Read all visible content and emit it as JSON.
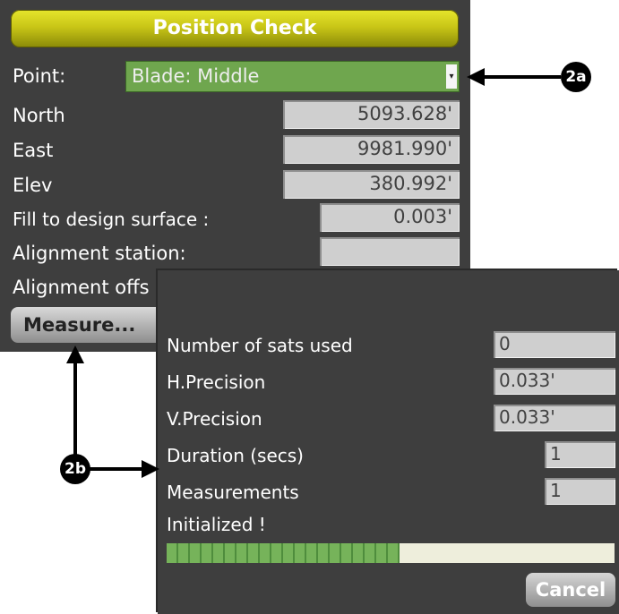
{
  "position_check": {
    "title": "Position Check",
    "point_label": "Point:",
    "point_value": "Blade: Middle",
    "fields": [
      {
        "label": "North",
        "value": "5093.628'"
      },
      {
        "label": "East",
        "value": "9981.990'"
      },
      {
        "label": "Elev",
        "value": "380.992'"
      },
      {
        "label": "Fill to design surface :",
        "value": "0.003'"
      },
      {
        "label": "Alignment station:",
        "value": ""
      },
      {
        "label": "Alignment offs",
        "value": ""
      }
    ],
    "measure_button": "Measure..."
  },
  "measure_dialog": {
    "rows": [
      {
        "label": "Number of sats used",
        "value": "0"
      },
      {
        "label": "H.Precision",
        "value": "0.033'"
      },
      {
        "label": "V.Precision",
        "value": "0.033'"
      },
      {
        "label": "Duration (secs)",
        "value": "1"
      },
      {
        "label": "Measurements",
        "value": "1"
      }
    ],
    "status": "Initialized !",
    "progress": 0.52,
    "cancel_button": "Cancel"
  },
  "callouts": {
    "a": "2a",
    "b": "2b"
  },
  "colors": {
    "panel": "#3e3e3e",
    "title_bar": "#c9c617",
    "select": "#6fa64e",
    "progress": "#76b35a"
  }
}
